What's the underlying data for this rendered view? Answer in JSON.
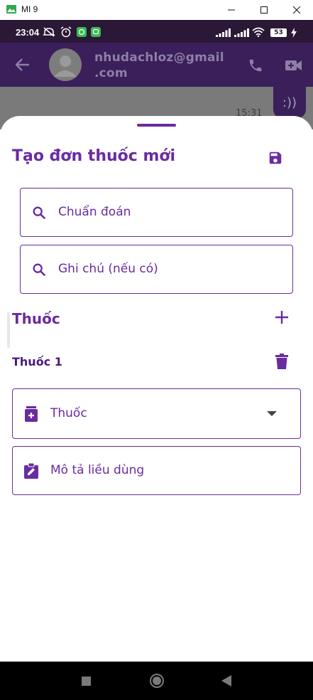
{
  "window": {
    "title": "MI 9"
  },
  "status": {
    "time": "23:04",
    "battery": "53"
  },
  "header": {
    "contact_line1": "nhudachloz@gmail",
    "contact_line2": ".com"
  },
  "chat": {
    "bubble_text": ":))",
    "time": "15:31"
  },
  "sheet": {
    "title": "Tạo đơn thuốc mới",
    "diagnosis_placeholder": "Chuẩn đoán",
    "note_placeholder": "Ghi chú (nếu có)",
    "medicine_section": "Thuốc",
    "item_title": "Thuốc 1",
    "medicine_select": "Thuốc",
    "dosage_placeholder": "Mô tả liều dùng"
  },
  "colors": {
    "accent": "#6a2ba0",
    "appbar": "#3a1f5a",
    "statusbar": "#2b1736"
  }
}
